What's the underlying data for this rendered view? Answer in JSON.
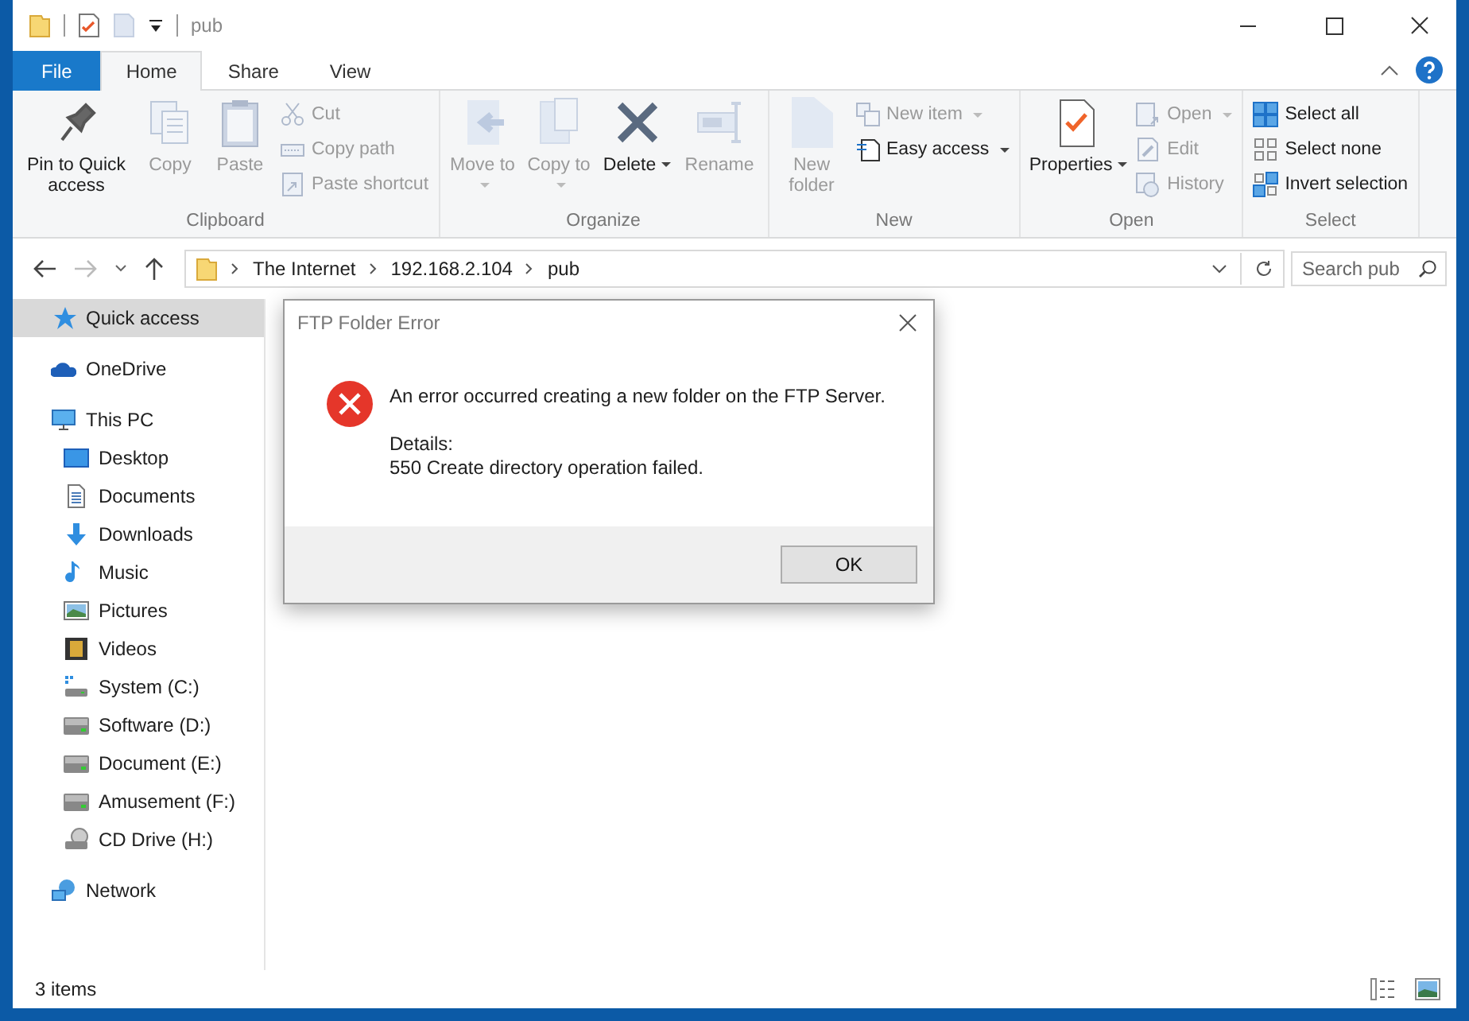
{
  "window": {
    "title": "pub"
  },
  "tabs": [
    {
      "label": "File",
      "kind": "file",
      "selected": false
    },
    {
      "label": "Home",
      "kind": "tab",
      "selected": true
    },
    {
      "label": "Share",
      "kind": "tab",
      "selected": false
    },
    {
      "label": "View",
      "kind": "tab",
      "selected": false
    }
  ],
  "ribbon": {
    "groups": [
      {
        "label": "Clipboard",
        "large": [
          {
            "label": "Pin to Quick access",
            "disabled": false,
            "dropdown": false
          },
          {
            "label": "Copy",
            "disabled": true,
            "dropdown": false
          },
          {
            "label": "Paste",
            "disabled": true,
            "dropdown": false
          }
        ],
        "small": [
          {
            "label": "Cut",
            "disabled": true,
            "dropdown": false
          },
          {
            "label": "Copy path",
            "disabled": true,
            "dropdown": false
          },
          {
            "label": "Paste shortcut",
            "disabled": true,
            "dropdown": false
          }
        ]
      },
      {
        "label": "Organize",
        "large": [
          {
            "label": "Move to",
            "disabled": true,
            "dropdown": true
          },
          {
            "label": "Copy to",
            "disabled": true,
            "dropdown": true
          },
          {
            "label": "Delete",
            "disabled": false,
            "dropdown": true
          },
          {
            "label": "Rename",
            "disabled": true,
            "dropdown": false
          }
        ]
      },
      {
        "label": "New",
        "large": [
          {
            "label": "New folder",
            "disabled": true,
            "dropdown": false
          }
        ],
        "small": [
          {
            "label": "New item",
            "disabled": true,
            "dropdown": true
          },
          {
            "label": "Easy access",
            "disabled": false,
            "dropdown": true
          }
        ]
      },
      {
        "label": "Open",
        "large": [
          {
            "label": "Properties",
            "disabled": false,
            "dropdown": true
          }
        ],
        "small": [
          {
            "label": "Open",
            "disabled": true,
            "dropdown": true
          },
          {
            "label": "Edit",
            "disabled": true,
            "dropdown": false
          },
          {
            "label": "History",
            "disabled": true,
            "dropdown": false
          }
        ]
      },
      {
        "label": "Select",
        "small": [
          {
            "label": "Select all",
            "disabled": false,
            "dropdown": false
          },
          {
            "label": "Select none",
            "disabled": false,
            "dropdown": false
          },
          {
            "label": "Invert selection",
            "disabled": false,
            "dropdown": false
          }
        ]
      }
    ]
  },
  "navigation": {
    "back_disabled": false,
    "forward_disabled": true
  },
  "address_bar": {
    "path": [
      "The Internet",
      "192.168.2.104",
      "pub"
    ]
  },
  "search": {
    "placeholder": "Search pub"
  },
  "sidebar": {
    "items": [
      {
        "label": "Quick access",
        "selected": true
      },
      {
        "label": "OneDrive",
        "selected": false
      },
      {
        "label": "This PC",
        "selected": false,
        "children": [
          {
            "label": "Desktop",
            "selected": false
          },
          {
            "label": "Documents",
            "selected": false
          },
          {
            "label": "Downloads",
            "selected": false
          },
          {
            "label": "Music",
            "selected": false
          },
          {
            "label": "Pictures",
            "selected": false
          },
          {
            "label": "Videos",
            "selected": false
          },
          {
            "label": "System (C:)",
            "selected": false
          },
          {
            "label": "Software (D:)",
            "selected": false
          },
          {
            "label": "Document (E:)",
            "selected": false
          },
          {
            "label": "Amusement (F:)",
            "selected": false
          },
          {
            "label": "CD Drive (H:)",
            "selected": false
          }
        ]
      },
      {
        "label": "Network",
        "selected": false
      }
    ]
  },
  "dialog": {
    "title": "FTP Folder Error",
    "message": "An error occurred creating a new folder on the FTP Server.",
    "details_label": "Details:",
    "details": "550 Create directory operation failed.",
    "buttons": [
      "OK"
    ]
  },
  "status_bar": {
    "text": "3 items"
  }
}
